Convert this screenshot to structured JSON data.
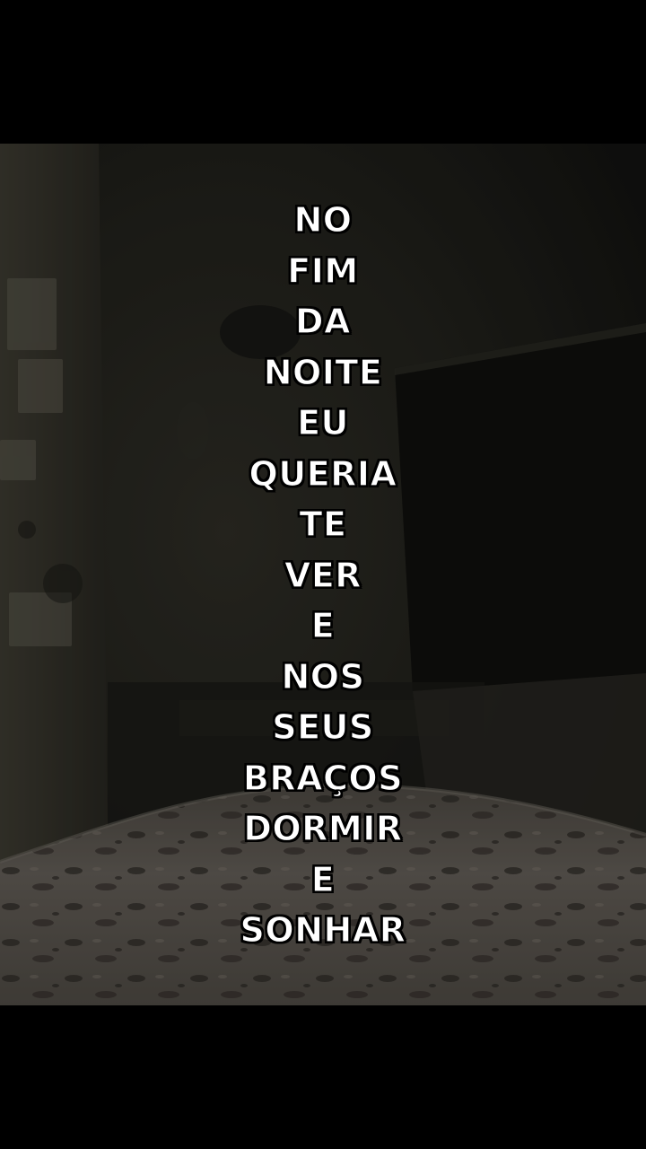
{
  "overlay_text": {
    "words": [
      "NO",
      "FIM",
      "DA",
      "NOITE",
      "EU",
      "QUERIA",
      "TE",
      "VER",
      "E",
      "NOS",
      "SEUS",
      "BRAÇOS",
      "DORMIR",
      "E",
      "SONHAR"
    ]
  },
  "colors": {
    "text": "#ffffff",
    "text_outline": "#000000",
    "letterbox": "#000000"
  }
}
